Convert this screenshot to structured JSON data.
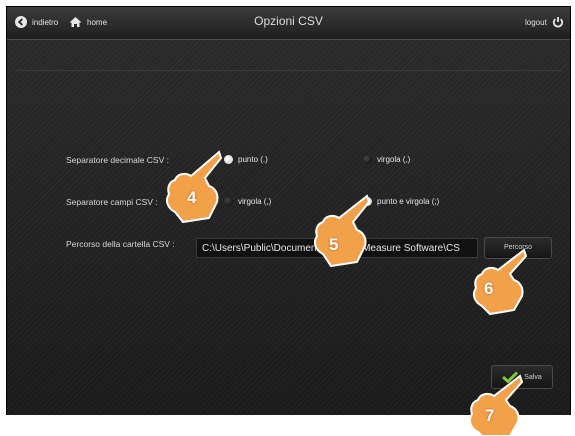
{
  "header": {
    "back_label": "indietro",
    "home_label": "home",
    "title": "Opzioni CSV",
    "logout_label": "logout"
  },
  "form": {
    "decimal_label": "Separatore decimale CSV :",
    "decimal_options": [
      "punto (.)",
      "virgola (,)"
    ],
    "decimal_selected": "punto (.)",
    "field_label": "Separatore campi CSV :",
    "field_options": [
      "virgola (,)",
      "punto e virgola (;)"
    ],
    "field_selected": "punto e virgola (;)",
    "path_label": "Percorso della cartella CSV :",
    "path_value": "C:\\Users\\Public\\Documents\\Techno Measure Software\\CS",
    "browse_label": "Percorso"
  },
  "footer": {
    "save_label": "Salva"
  },
  "callouts": [
    "4",
    "5",
    "6",
    "7"
  ],
  "icons": [
    "back-arrow-icon",
    "home-icon",
    "power-icon",
    "checkmark-icon",
    "pointing-hand-icon"
  ],
  "colors": {
    "accent_check": "#7ac943",
    "hand": "#f2a04a",
    "background": "#1b1b1b"
  }
}
